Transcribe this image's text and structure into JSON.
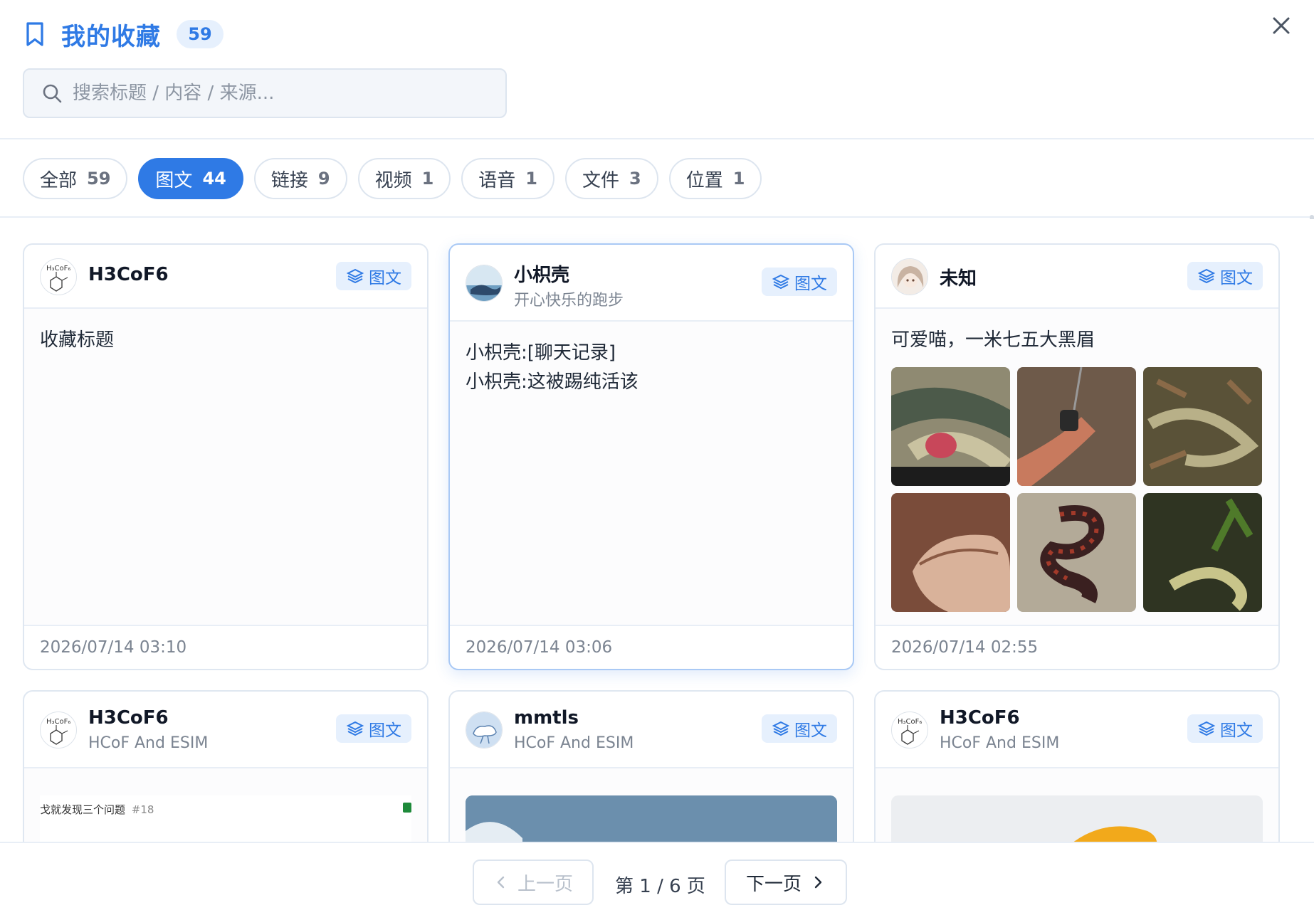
{
  "header": {
    "title": "我的收藏",
    "count": "59",
    "search_placeholder": "搜索标题 / 内容 / 来源..."
  },
  "filters": [
    {
      "label": "全部",
      "count": "59",
      "active": false
    },
    {
      "label": "图文",
      "count": "44",
      "active": true
    },
    {
      "label": "链接",
      "count": "9",
      "active": false
    },
    {
      "label": "视频",
      "count": "1",
      "active": false
    },
    {
      "label": "语音",
      "count": "1",
      "active": false
    },
    {
      "label": "文件",
      "count": "3",
      "active": false
    },
    {
      "label": "位置",
      "count": "1",
      "active": false
    }
  ],
  "cards": [
    {
      "author": "H3CoF6",
      "subtitle": "",
      "type": "图文",
      "text": "收藏标题",
      "time": "2026/07/14 03:10"
    },
    {
      "author": "小枳壳",
      "subtitle": "开心快乐的跑步",
      "type": "图文",
      "text_lines": [
        "小枳壳:[聊天记录]",
        "小枳壳:这被踢纯活该"
      ],
      "time": "2026/07/14 03:06"
    },
    {
      "author": "未知",
      "subtitle": "",
      "type": "图文",
      "text": "可爱喵，一米七五大黑眉",
      "time": "2026/07/14 02:55"
    },
    {
      "author": "H3CoF6",
      "subtitle": "HCoF And ESIM",
      "type": "图文",
      "preview_text": "戈就发现三个问题",
      "preview_tag": "#18"
    },
    {
      "author": "mmtls",
      "subtitle": "HCoF And ESIM",
      "type": "图文"
    },
    {
      "author": "H3CoF6",
      "subtitle": "HCoF And ESIM",
      "type": "图文"
    }
  ],
  "pagination": {
    "prev_label": "上一页",
    "page_info": "第 1 / 6 页",
    "next_label": "下一页"
  },
  "colors": {
    "accent": "#2f7ae5",
    "badge_bg": "#e6f0fd"
  }
}
